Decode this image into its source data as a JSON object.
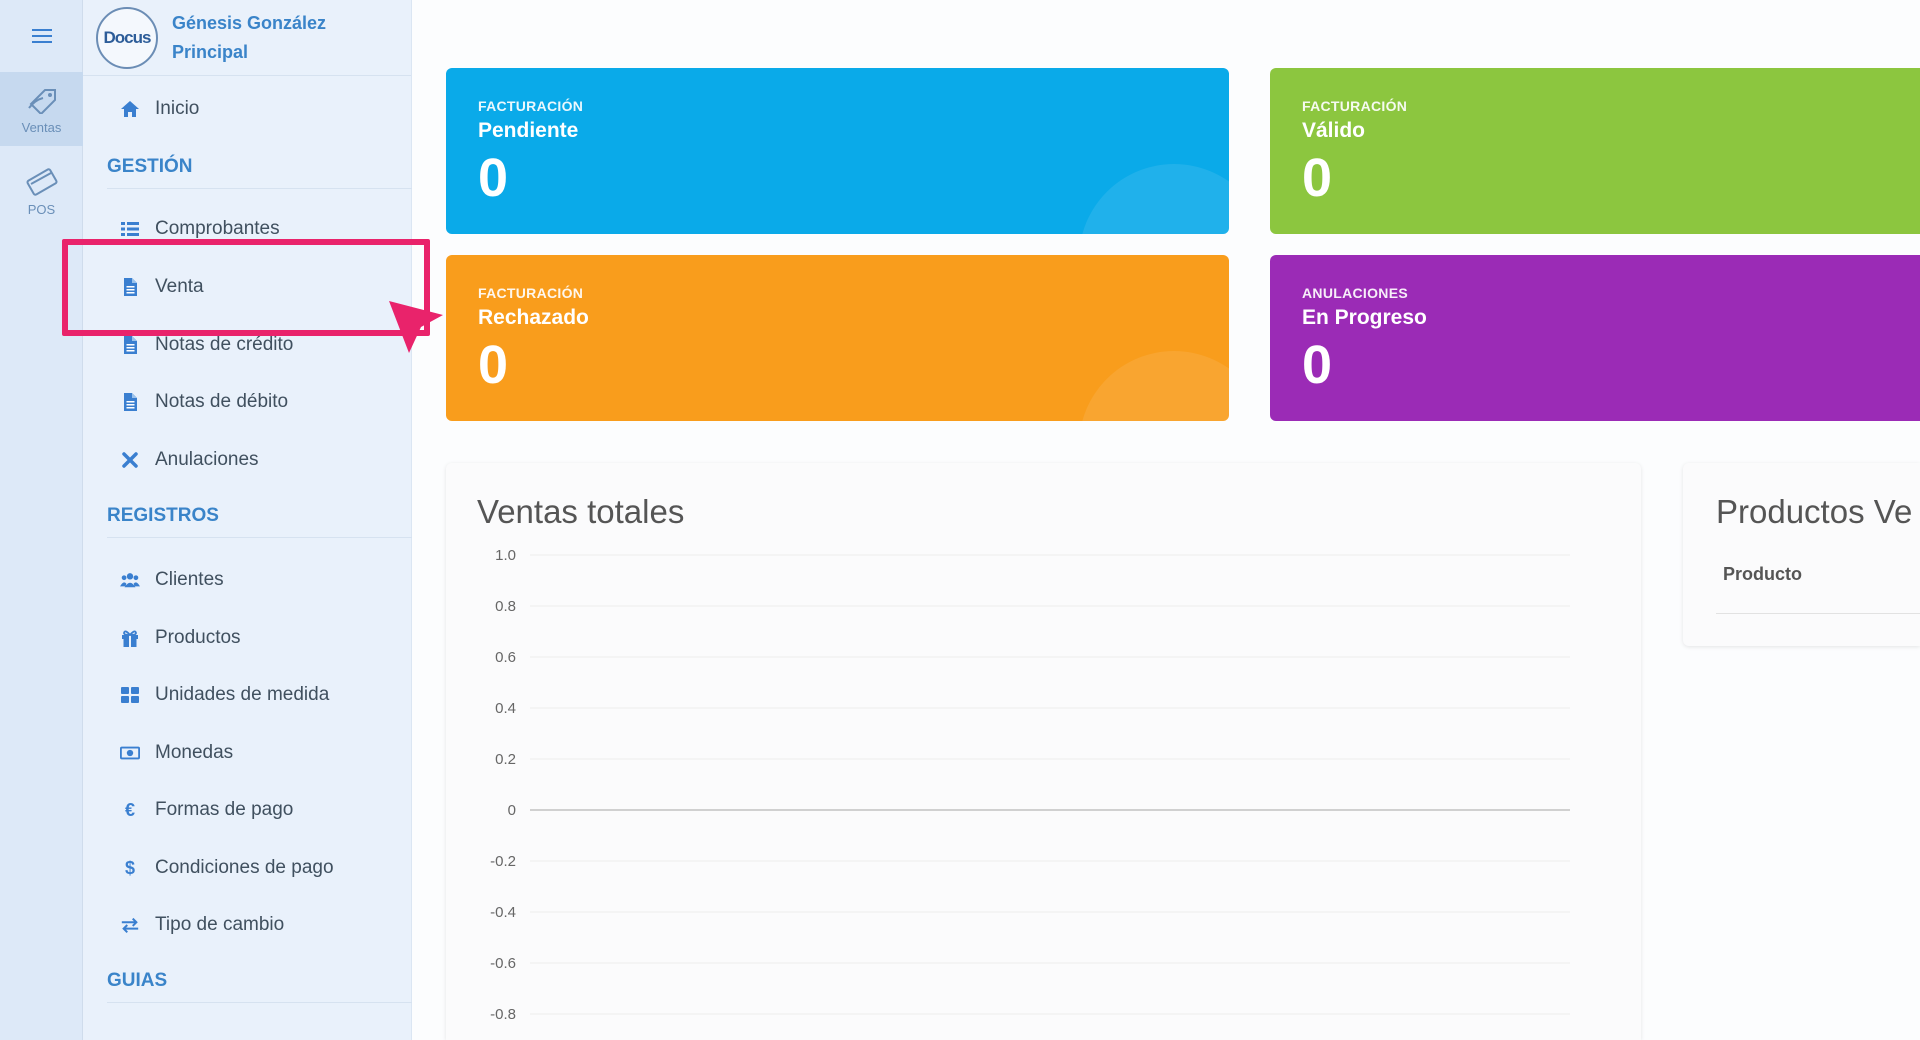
{
  "rail": {
    "items": [
      {
        "label": "Ventas",
        "icon": "sales-tag-icon",
        "active": true
      },
      {
        "label": "POS",
        "icon": "pos-card-icon",
        "active": false
      }
    ]
  },
  "profile": {
    "logo_text": "Docus",
    "name": "Génesis González",
    "role": "Principal"
  },
  "nav": {
    "inicio": {
      "label": "Inicio",
      "icon": "home-icon"
    },
    "gestion_title": "GESTIÓN",
    "gestion_items": [
      {
        "label": "Comprobantes",
        "icon": "list-icon"
      },
      {
        "label": "Venta",
        "icon": "document-icon"
      },
      {
        "label": "Notas de crédito",
        "icon": "document-icon"
      },
      {
        "label": "Notas de débito",
        "icon": "document-icon"
      },
      {
        "label": "Anulaciones",
        "icon": "cross-icon"
      }
    ],
    "registros_title": "REGISTROS",
    "registros_items": [
      {
        "label": "Clientes",
        "icon": "users-icon"
      },
      {
        "label": "Productos",
        "icon": "gift-icon"
      },
      {
        "label": "Unidades de medida",
        "icon": "grid-icon"
      },
      {
        "label": "Monedas",
        "icon": "money-icon"
      },
      {
        "label": "Formas de pago",
        "icon": "euro-icon"
      },
      {
        "label": "Condiciones de pago",
        "icon": "dollar-icon"
      },
      {
        "label": "Tipo de cambio",
        "icon": "exchange-icon"
      }
    ],
    "guias_title": "GUIAS"
  },
  "cards": [
    {
      "small": "FACTURACIÓN",
      "label": "Pendiente",
      "value": "0",
      "color": "#0aaae9"
    },
    {
      "small": "FACTURACIÓN",
      "label": "Válido",
      "value": "0",
      "color": "#8cc63f"
    },
    {
      "small": "FACTURACIÓN",
      "label": "Rechazado",
      "value": "0",
      "color": "#f99d1c"
    },
    {
      "small": "ANULACIONES",
      "label": "En Progreso",
      "value": "0",
      "color": "#9b2bb6"
    }
  ],
  "sales_panel": {
    "title": "Ventas totales"
  },
  "products_panel": {
    "title": "Productos Ve",
    "column": "Producto"
  },
  "chart_data": {
    "type": "line",
    "title": "Ventas totales",
    "y_ticks": [
      "1.0",
      "0.8",
      "0.6",
      "0.4",
      "0.2",
      "0",
      "-0.2",
      "-0.4",
      "-0.6",
      "-0.8"
    ],
    "ylim": [
      -0.8,
      1.0
    ],
    "series": [],
    "grid": true
  },
  "colors": {
    "accent": "#3a84c9",
    "highlight": "#e9236b"
  }
}
